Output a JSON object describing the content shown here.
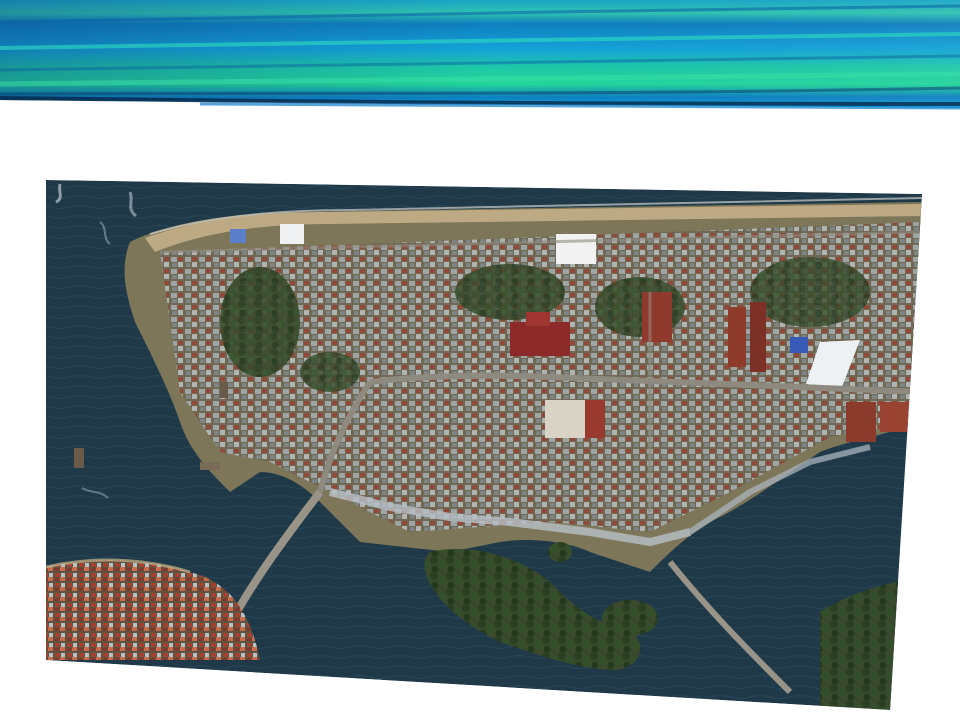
{
  "slide": {
    "banner": {
      "colors": [
        "#0a7fc4",
        "#14a6d8",
        "#1fd2a0",
        "#0f5fa8",
        "#0b2a5a"
      ]
    },
    "photo": {
      "kind": "aerial satellite photograph",
      "palette": {
        "sea_deep": "#1c3444",
        "sea": "#2b4a5a",
        "shallow_water": "#3a5560",
        "land": "#8a8660",
        "vegetation": "#2f4a2a",
        "roof_red": "#9a3a2e",
        "roof_metal": "#a9b4bf",
        "road": "#8f8a80",
        "sand": "#c8b48c",
        "white_roof": "#f2f2f2"
      }
    }
  }
}
